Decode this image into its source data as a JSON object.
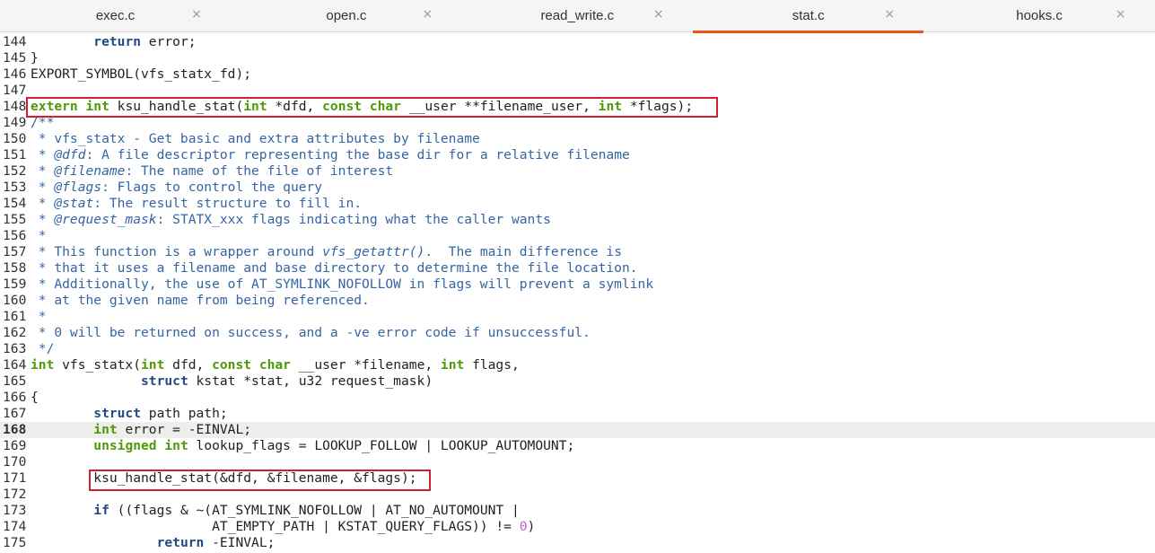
{
  "tabs": [
    {
      "label": "exec.c",
      "close": "×"
    },
    {
      "label": "open.c",
      "close": "×"
    },
    {
      "label": "read_write.c",
      "close": "×"
    },
    {
      "label": "stat.c",
      "close": "×",
      "active": true
    },
    {
      "label": "hooks.c",
      "close": "×"
    }
  ],
  "active_tab": "stat.c",
  "editor": {
    "current_line": "168",
    "lines": [
      {
        "n": "144",
        "tokens": [
          [
            "",
            "        "
          ],
          [
            "kw",
            "return"
          ],
          [
            "",
            " error;"
          ]
        ]
      },
      {
        "n": "145",
        "tokens": [
          [
            "",
            "}"
          ]
        ]
      },
      {
        "n": "146",
        "tokens": [
          [
            "",
            "EXPORT_SYMBOL(vfs_statx_fd);"
          ]
        ]
      },
      {
        "n": "147",
        "tokens": []
      },
      {
        "n": "148",
        "tokens": [
          [
            "ty",
            "extern"
          ],
          [
            "",
            " "
          ],
          [
            "ty",
            "int"
          ],
          [
            "",
            " ksu_handle_stat("
          ],
          [
            "ty",
            "int"
          ],
          [
            "",
            " *dfd, "
          ],
          [
            "ty",
            "const"
          ],
          [
            "",
            " "
          ],
          [
            "ty",
            "char"
          ],
          [
            "",
            " __user **filename_user, "
          ],
          [
            "ty",
            "int"
          ],
          [
            "",
            " *flags);"
          ]
        ]
      },
      {
        "n": "149",
        "tokens": [
          [
            "cm",
            "/**"
          ]
        ]
      },
      {
        "n": "150",
        "tokens": [
          [
            "cm",
            " * vfs_statx - Get basic and extra attributes by filename"
          ]
        ]
      },
      {
        "n": "151",
        "tokens": [
          [
            "cm",
            " * "
          ],
          [
            "cmi",
            "@dfd"
          ],
          [
            "cm",
            ": A file descriptor representing the base dir for a relative filename"
          ]
        ]
      },
      {
        "n": "152",
        "tokens": [
          [
            "cm",
            " * "
          ],
          [
            "cmi",
            "@filename"
          ],
          [
            "cm",
            ": The name of the file of interest"
          ]
        ]
      },
      {
        "n": "153",
        "tokens": [
          [
            "cm",
            " * "
          ],
          [
            "cmi",
            "@flags"
          ],
          [
            "cm",
            ": Flags to control the query"
          ]
        ]
      },
      {
        "n": "154",
        "tokens": [
          [
            "cm",
            " * "
          ],
          [
            "cmi",
            "@stat"
          ],
          [
            "cm",
            ": The result structure to fill in."
          ]
        ]
      },
      {
        "n": "155",
        "tokens": [
          [
            "cm",
            " * "
          ],
          [
            "cmi",
            "@request_mask"
          ],
          [
            "cm",
            ": STATX_xxx flags indicating what the caller wants"
          ]
        ]
      },
      {
        "n": "156",
        "tokens": [
          [
            "cm",
            " *"
          ]
        ]
      },
      {
        "n": "157",
        "tokens": [
          [
            "cm",
            " * This function is a wrapper around "
          ],
          [
            "cmi",
            "vfs_getattr()"
          ],
          [
            "cm",
            ".  The main difference is"
          ]
        ]
      },
      {
        "n": "158",
        "tokens": [
          [
            "cm",
            " * that it uses a filename and base directory to determine the file location."
          ]
        ]
      },
      {
        "n": "159",
        "tokens": [
          [
            "cm",
            " * Additionally, the use of AT_SYMLINK_NOFOLLOW in flags will prevent a symlink"
          ]
        ]
      },
      {
        "n": "160",
        "tokens": [
          [
            "cm",
            " * at the given name from being referenced."
          ]
        ]
      },
      {
        "n": "161",
        "tokens": [
          [
            "cm",
            " *"
          ]
        ]
      },
      {
        "n": "162",
        "tokens": [
          [
            "cm",
            " * 0 will be returned on success, and a -ve error code if unsuccessful."
          ]
        ]
      },
      {
        "n": "163",
        "tokens": [
          [
            "cm",
            " */"
          ]
        ]
      },
      {
        "n": "164",
        "tokens": [
          [
            "ty",
            "int"
          ],
          [
            "",
            " vfs_statx("
          ],
          [
            "ty",
            "int"
          ],
          [
            "",
            " dfd, "
          ],
          [
            "ty",
            "const"
          ],
          [
            "",
            " "
          ],
          [
            "ty",
            "char"
          ],
          [
            "",
            " __user *filename, "
          ],
          [
            "ty",
            "int"
          ],
          [
            "",
            " flags,"
          ]
        ]
      },
      {
        "n": "165",
        "tokens": [
          [
            "",
            "              "
          ],
          [
            "kw",
            "struct"
          ],
          [
            "",
            " kstat *stat, u32 request_mask)"
          ]
        ]
      },
      {
        "n": "166",
        "tokens": [
          [
            "",
            "{"
          ]
        ]
      },
      {
        "n": "167",
        "tokens": [
          [
            "",
            "        "
          ],
          [
            "kw",
            "struct"
          ],
          [
            "",
            " path path;"
          ]
        ]
      },
      {
        "n": "168",
        "tokens": [
          [
            "",
            "        "
          ],
          [
            "ty",
            "int"
          ],
          [
            "",
            " error = -EINVAL;"
          ]
        ]
      },
      {
        "n": "169",
        "tokens": [
          [
            "",
            "        "
          ],
          [
            "ty",
            "unsigned"
          ],
          [
            "",
            " "
          ],
          [
            "ty",
            "int"
          ],
          [
            "",
            " lookup_flags = LOOKUP_FOLLOW | LOOKUP_AUTOMOUNT;"
          ]
        ]
      },
      {
        "n": "170",
        "tokens": []
      },
      {
        "n": "171",
        "tokens": [
          [
            "",
            "        ksu_handle_stat(&dfd, &filename, &flags);"
          ]
        ]
      },
      {
        "n": "172",
        "tokens": []
      },
      {
        "n": "173",
        "tokens": [
          [
            "",
            "        "
          ],
          [
            "kw",
            "if"
          ],
          [
            "",
            " ((flags & ~(AT_SYMLINK_NOFOLLOW | AT_NO_AUTOMOUNT |"
          ]
        ]
      },
      {
        "n": "174",
        "tokens": [
          [
            "",
            "                       AT_EMPTY_PATH | KSTAT_QUERY_FLAGS)) != "
          ],
          [
            "num",
            "0"
          ],
          [
            "",
            ")"
          ]
        ]
      },
      {
        "n": "175",
        "tokens": [
          [
            "",
            "                "
          ],
          [
            "kw",
            "return"
          ],
          [
            "",
            " -EINVAL;"
          ]
        ]
      }
    ]
  }
}
